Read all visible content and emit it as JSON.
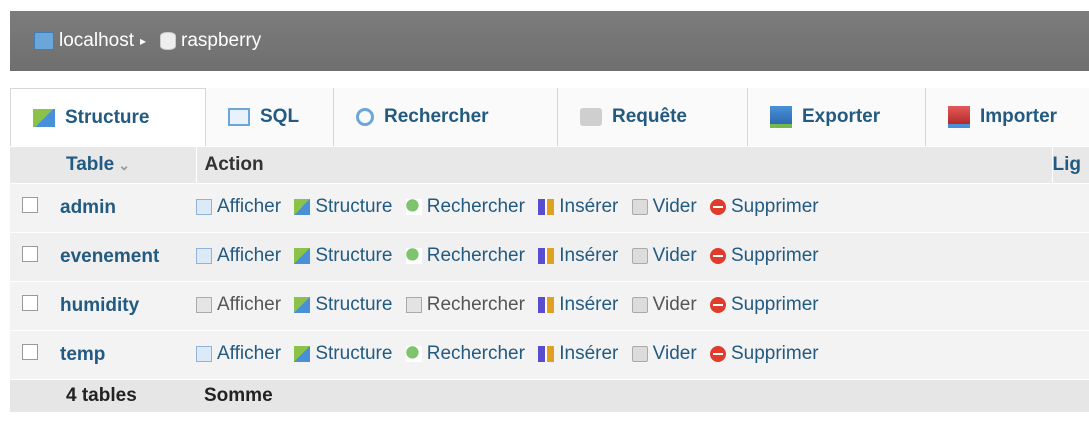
{
  "breadcrumb": {
    "server": "localhost",
    "database": "raspberry",
    "separator": "▸"
  },
  "tabs": [
    {
      "label": "Structure",
      "icon": "structure-icon",
      "active": true
    },
    {
      "label": "SQL",
      "icon": "sql-icon"
    },
    {
      "label": "Rechercher",
      "icon": "search-icon"
    },
    {
      "label": "Requête",
      "icon": "query-icon"
    },
    {
      "label": "Exporter",
      "icon": "export-icon"
    },
    {
      "label": "Importer",
      "icon": "import-icon"
    }
  ],
  "table": {
    "headers": {
      "table": "Table",
      "action": "Action",
      "rows": "Lig",
      "sort_indicator": "⌄"
    },
    "actions": {
      "browse": "Afficher",
      "structure": "Structure",
      "search": "Rechercher",
      "insert": "Insérer",
      "empty": "Vider",
      "drop": "Supprimer"
    },
    "rows": [
      {
        "name": "admin"
      },
      {
        "name": "evenement"
      },
      {
        "name": "humidity"
      },
      {
        "name": "temp"
      }
    ],
    "footer": {
      "count": "4 tables",
      "sum": "Somme"
    }
  },
  "colors": {
    "link": "#235a81",
    "header_bar": "#777777",
    "drop": "#e03b2b"
  }
}
